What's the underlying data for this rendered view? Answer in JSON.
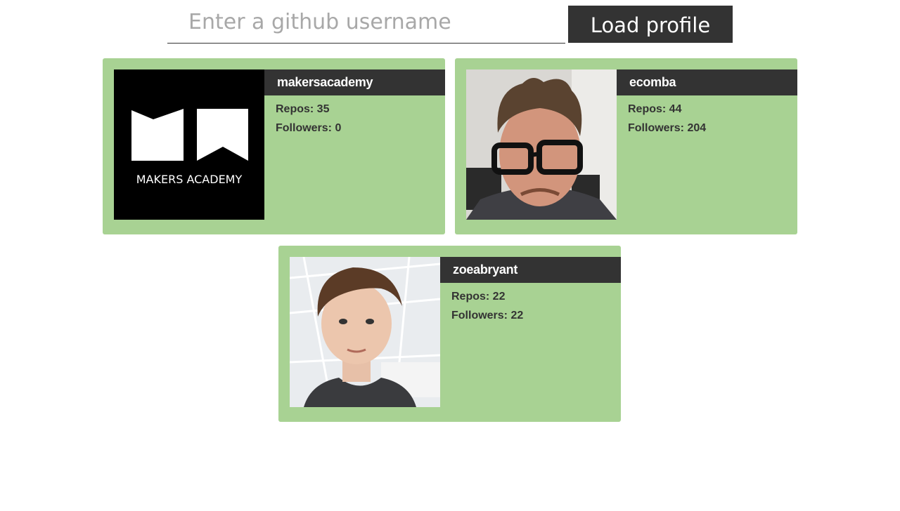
{
  "search": {
    "placeholder": "Enter a github username",
    "value": "",
    "button_label": "Load profile"
  },
  "profiles": [
    {
      "username": "makersacademy",
      "repos_text": "Repos: 35",
      "followers_text": "Followers: 0",
      "avatar_icon": "makers-academy-logo",
      "avatar_caption": "MAKERS ACADEMY"
    },
    {
      "username": "ecomba",
      "repos_text": "Repos: 44",
      "followers_text": "Followers: 204",
      "avatar_icon": "user-photo"
    },
    {
      "username": "zoeabryant",
      "repos_text": "Repos: 22",
      "followers_text": "Followers: 22",
      "avatar_icon": "user-photo"
    }
  ],
  "colors": {
    "card_bg": "#a8d293",
    "dark": "#333333",
    "placeholder": "#a8a8a8"
  }
}
